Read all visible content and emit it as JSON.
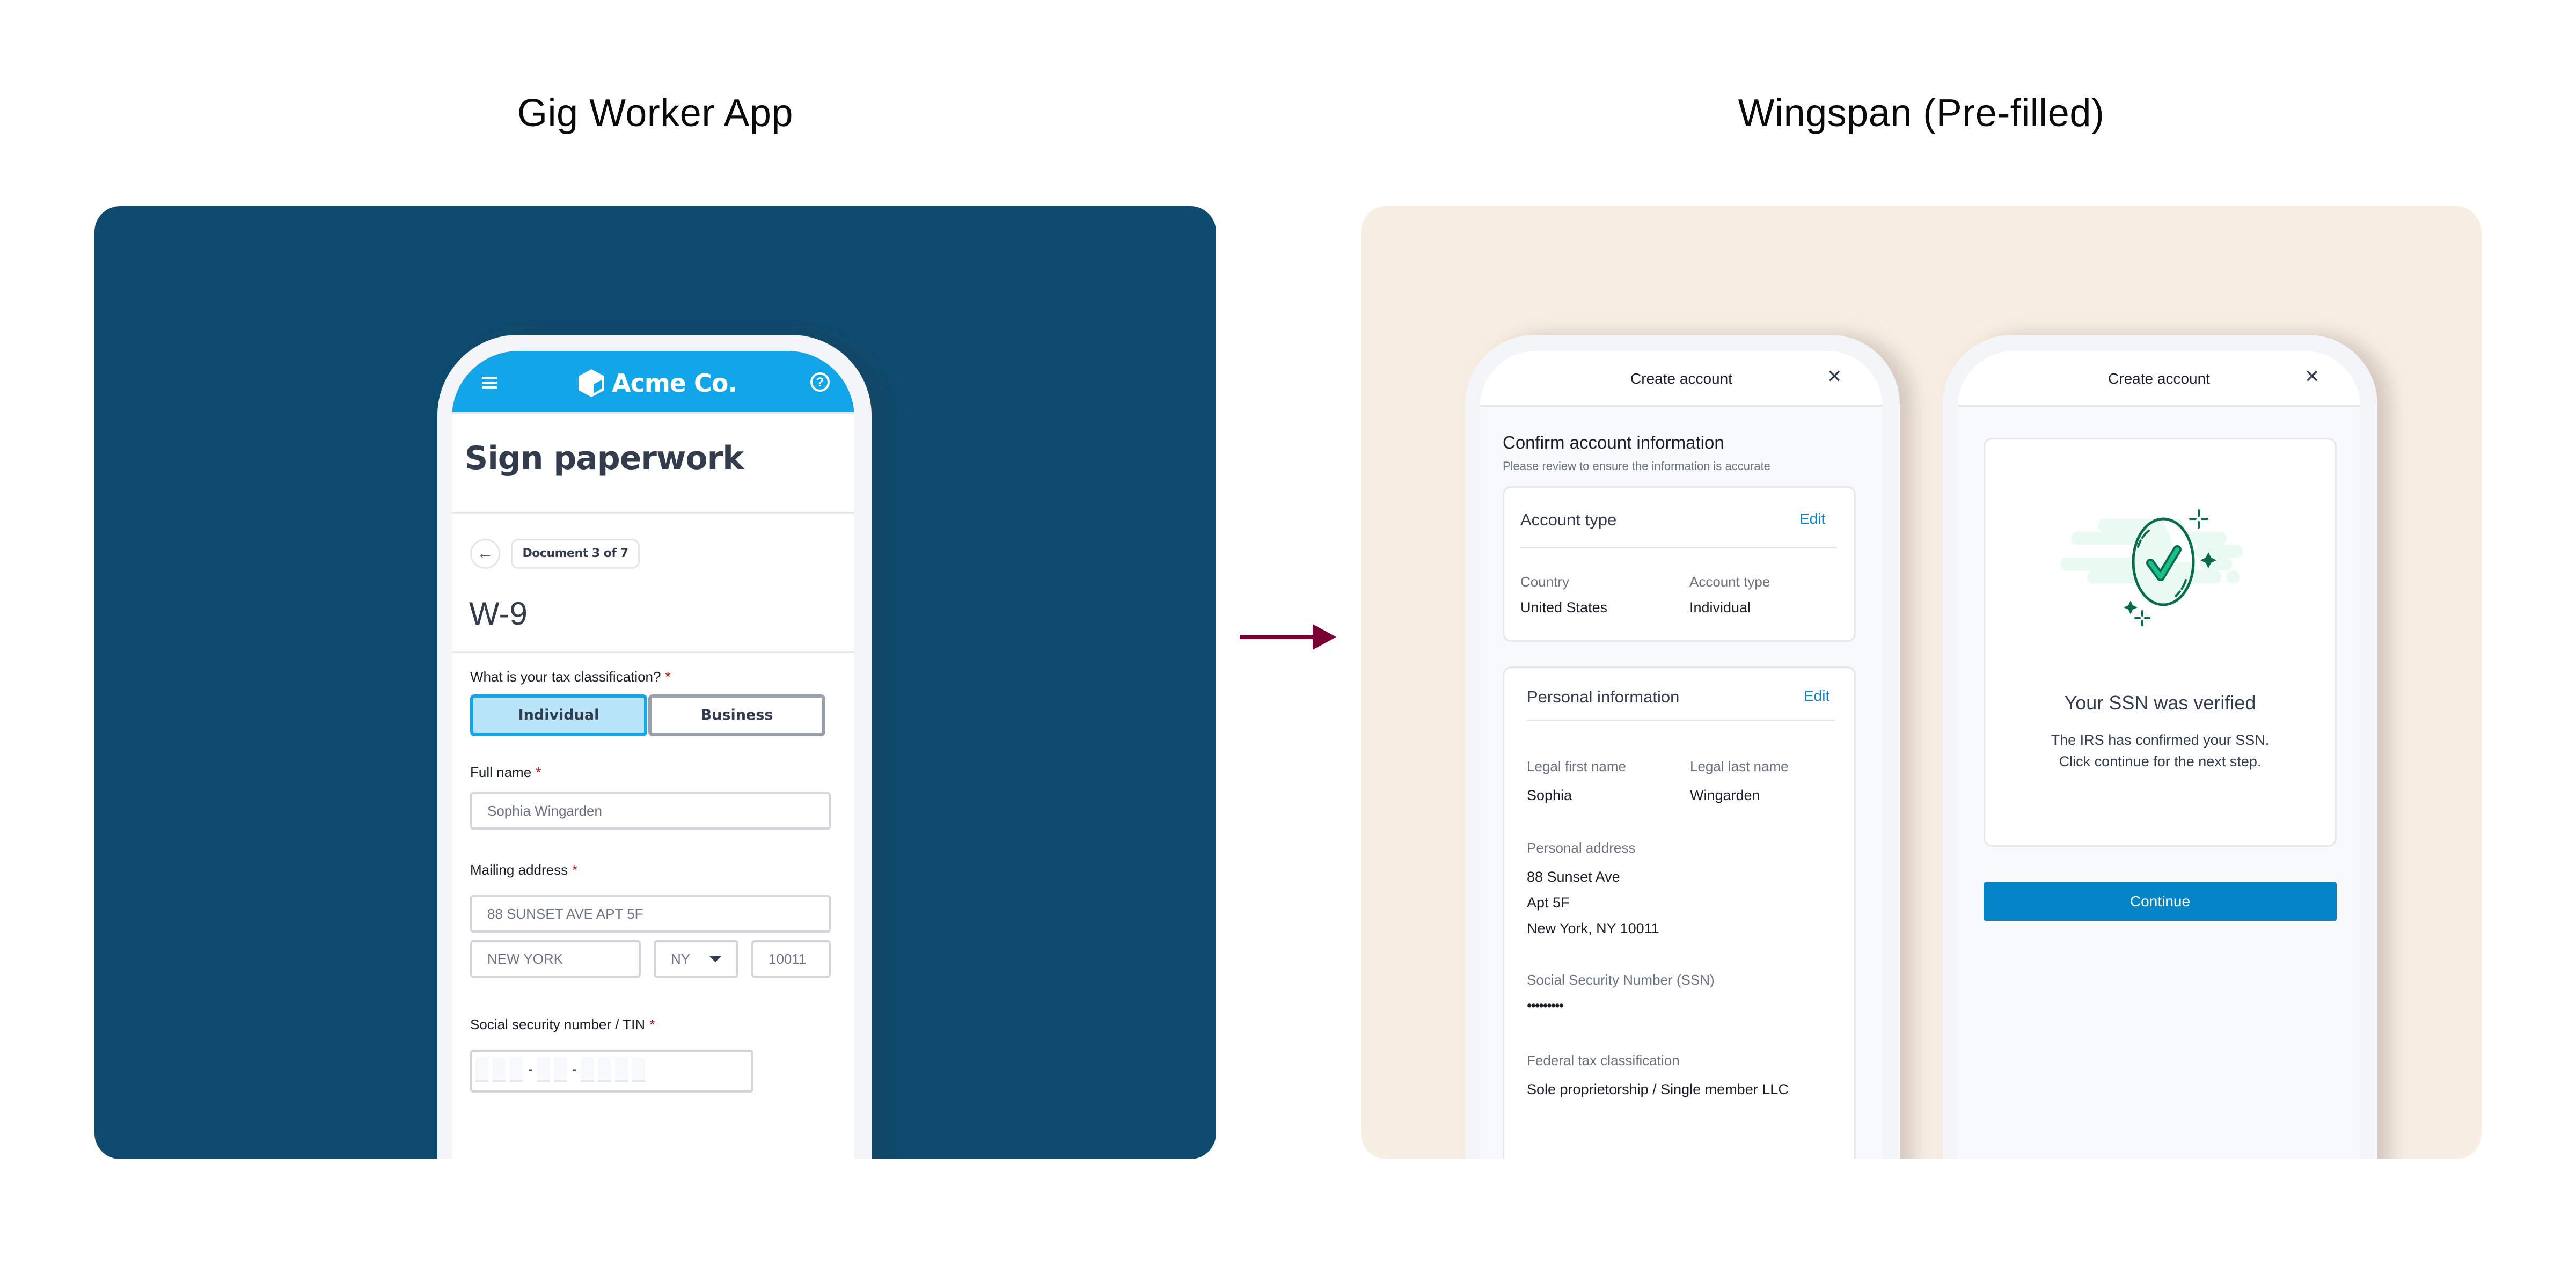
{
  "titles": {
    "left": "Gig Worker App",
    "right": "Wingspan (Pre-filled)"
  },
  "colors": {
    "left_panel": "#0e4b6e",
    "right_panel": "#f8efe2",
    "acme_blue": "#12a5e8",
    "flow_arrow": "#7a0033",
    "wingspan_blue": "#0585c7",
    "success_green": "#0a6b4d"
  },
  "flow_arrow": {
    "icon": "arrow-right-icon"
  },
  "gig_app": {
    "header": {
      "menu_icon": "hamburger-icon",
      "logo_icon": "cube-icon",
      "brand": "Acme Co.",
      "help_icon": "help-circle-icon",
      "help_glyph": "?"
    },
    "page_title": "Sign paperwork",
    "back_icon": "arrow-left-icon",
    "back_glyph": "←",
    "document_progress": "Document 3 of 7",
    "form_title": "W-9",
    "tax_classification": {
      "label": "What is your tax classification?",
      "required_mark": "*",
      "options": [
        "Individual",
        "Business"
      ],
      "selected": "Individual"
    },
    "full_name": {
      "label": "Full name",
      "required_mark": "*",
      "value": "Sophia Wingarden"
    },
    "mailing_address": {
      "label": "Mailing address",
      "required_mark": "*",
      "street": "88 SUNSET AVE APT 5F",
      "city": "NEW YORK",
      "state": "NY",
      "zip": "10011"
    },
    "ssn": {
      "label": "Social security number / TIN",
      "required_mark": "*",
      "separator": "-",
      "digit_groups": [
        3,
        2,
        4
      ]
    }
  },
  "wingspan_confirm": {
    "header_title": "Create account",
    "close_glyph": "✕",
    "title": "Confirm account information",
    "subtitle": "Please review to ensure the information is accurate",
    "account_type_card": {
      "title": "Account type",
      "edit_label": "Edit",
      "fields": [
        {
          "label": "Country",
          "value": "United States"
        },
        {
          "label": "Account type",
          "value": "Individual"
        }
      ]
    },
    "personal_info_card": {
      "title": "Personal information",
      "edit_label": "Edit",
      "first_name": {
        "label": "Legal first name",
        "value": "Sophia"
      },
      "last_name": {
        "label": "Legal last name",
        "value": "Wingarden"
      },
      "address": {
        "label": "Personal address",
        "lines": [
          "88 Sunset Ave",
          "Apt 5F",
          "New York, NY 10011"
        ]
      },
      "ssn": {
        "label": "Social Security Number (SSN)",
        "value": "•••••••••"
      },
      "tax_classification": {
        "label": "Federal tax classification",
        "value": "Sole proprietorship / Single member LLC"
      }
    }
  },
  "wingspan_verified": {
    "header_title": "Create account",
    "close_glyph": "✕",
    "illustration_icon": "verified-check-icon",
    "title": "Your SSN was verified",
    "body_line1": "The IRS has confirmed your SSN.",
    "body_line2": "Click continue for the next step.",
    "continue_label": "Continue"
  }
}
